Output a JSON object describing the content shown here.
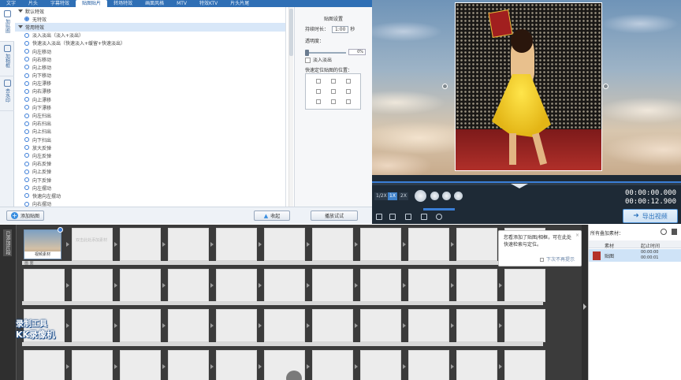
{
  "top_tabs": [
    "文字",
    "片头",
    "字幕特效",
    "贴图贴片",
    "转场特效",
    "画面风格",
    "MTV",
    "特效KTV",
    "片头片尾"
  ],
  "active_tab_index": 3,
  "side_tabs": [
    {
      "label": "加贴图",
      "icon": "sticker-icon"
    },
    {
      "label": "加相框",
      "icon": "frame-icon"
    },
    {
      "label": "去水印",
      "icon": "watermark-icon"
    }
  ],
  "effects": {
    "group_default": "默认特效",
    "no_effect": "无特效",
    "group_common": "常用特效",
    "items": [
      "淡入淡出（淡入+淡出）",
      "快速淡入淡出（快速淡入+缓留+快速淡出）",
      "向左移动",
      "向右移动",
      "向上移动",
      "向下移动",
      "向左漂移",
      "向右漂移",
      "向上漂移",
      "向下漂移",
      "向左扫出",
      "向右扫出",
      "向上扫出",
      "向下扫出",
      "放大反弹",
      "向左反弹",
      "向右反弹",
      "向上反弹",
      "向下反弹",
      "向左摆动",
      "快速向左摆动",
      "向右摆动"
    ]
  },
  "settings": {
    "title": "贴图设置",
    "duration_label": "持续时长：",
    "duration_value": "1:00",
    "duration_unit": "秒",
    "opacity_label": "透明度：",
    "opacity_value": "0%",
    "fade_label": "淡入淡出",
    "position_label": "快速定位贴图的位置："
  },
  "buttons": {
    "add_sticker": "添加贴图",
    "collapse": "收起",
    "preview_play": "播放试试",
    "export": "导出视频"
  },
  "player": {
    "speeds": [
      "1/2X",
      "1X",
      "2X"
    ],
    "active_speed": "1X",
    "current_time": "00:00:00.000",
    "total_time": "00:00:12.900"
  },
  "timeline": {
    "side_label": "已添加片段",
    "clip_label": "视频素材",
    "placeholder_text": "双击此处添加素材",
    "track_label": "画 面",
    "watermark_line1": "录制工具",
    "watermark_line2": "KK录像机"
  },
  "tooltip": {
    "text": "您看添加了贴图/相框，可在此处快速检索与定位。",
    "dont_show": "下次不再提示"
  },
  "right_pane": {
    "title": "所有叠加素材：",
    "col_material": "素材",
    "col_time": "起止时间",
    "row_name": "贴图",
    "row_start": "00:00:00",
    "row_end": "00:00:01"
  },
  "colors": {
    "accent": "#2f6fb5",
    "highlight": "#3b7dd8",
    "timeline_bg": "#3b3b3b"
  }
}
